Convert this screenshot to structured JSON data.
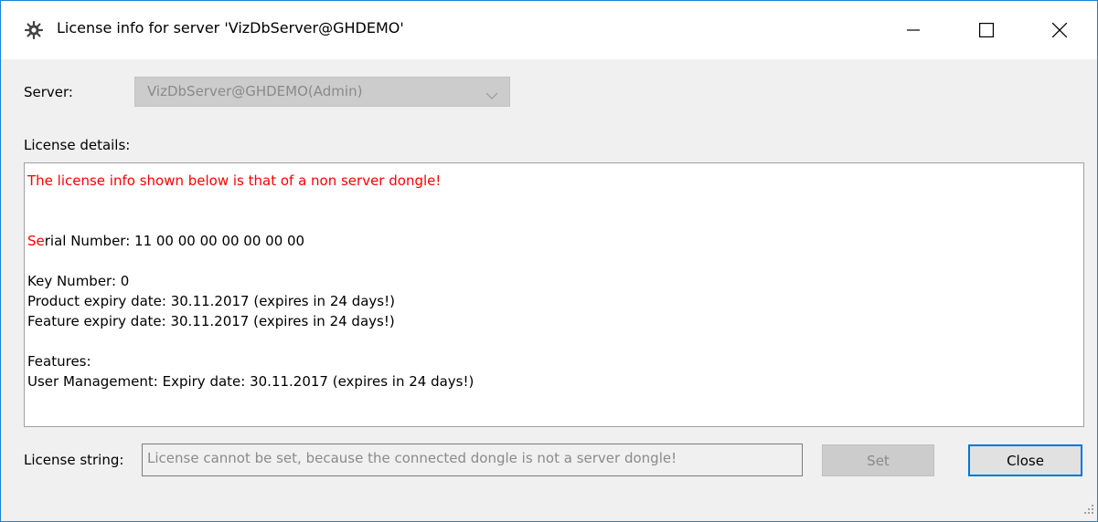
{
  "window": {
    "title": "License info for server 'VizDbServer@GHDEMO'",
    "icon": "gear-icon",
    "controls": [
      "minimize-icon",
      "maximize-icon",
      "close-icon"
    ]
  },
  "server": {
    "label": "Server:",
    "value": "VizDbServer@GHDEMO(Admin)"
  },
  "details": {
    "label": "License details:",
    "warning": "The license info shown below is that of a non server dongle!",
    "serial_prefix": "Se",
    "serial_rest": "rial Number: 11 00 00 00 00 00 00 00",
    "key_number": "Key Number: 0",
    "product_expiry": "Product expiry date: 30.11.2017 (expires in 24 days!)",
    "feature_expiry": "Feature expiry date: 30.11.2017 (expires in 24 days!)",
    "features_heading": "Features:",
    "feature_user_mgmt": "User Management: Expiry date: 30.11.2017 (expires in 24 days!)"
  },
  "license_string": {
    "label": "License string:",
    "value": "License cannot be set, because the connected dongle is not a server dongle!"
  },
  "buttons": {
    "set": "Set",
    "close": "Close"
  },
  "colors": {
    "warning": "#ff0000",
    "accent": "#0078d7"
  }
}
